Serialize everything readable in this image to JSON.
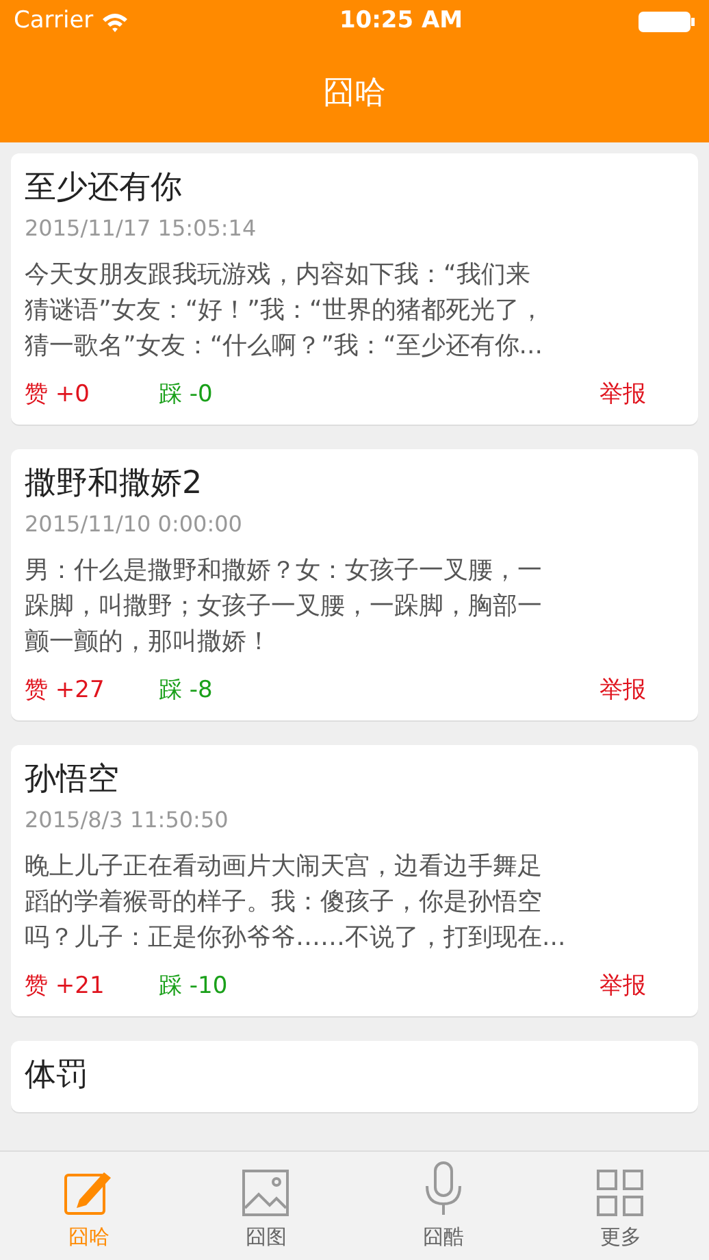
{
  "status_bar": {
    "carrier": "Carrier",
    "time": "10:25 AM"
  },
  "nav_bar": {
    "title": "囧哈"
  },
  "posts": [
    {
      "title": "至少还有你",
      "date": "2015/11/17 15:05:14",
      "body_lines": [
        "今天女朋友跟我玩游戏，内容如下我：“我们来",
        "猜谜语”女友：“好！”我：“世界的猪都死光了，",
        "猜一歌名”女友：“什么啊？”我：“至少还有你..."
      ],
      "likes": "赞 +0",
      "dislikes": "踩 -0",
      "report": "举报"
    },
    {
      "title": "撒野和撒娇2",
      "date": "2015/11/10 0:00:00",
      "body_lines": [
        "男：什么是撒野和撒娇？女：女孩子一叉腰，一",
        "跺脚，叫撒野；女孩子一叉腰，一跺脚，胸部一",
        "颤一颤的，那叫撒娇！"
      ],
      "likes": "赞 +27",
      "dislikes": "踩 -8",
      "report": "举报"
    },
    {
      "title": "孙悟空",
      "date": "2015/8/3 11:50:50",
      "body_lines": [
        "晚上儿子正在看动画片大闹天宫，边看边手舞足",
        "蹈的学着猴哥的样子。我：傻孩子，你是孙悟空",
        "吗？儿子：正是你孙爷爷……不说了，打到现在..."
      ],
      "likes": "赞 +21",
      "dislikes": "踩 -10",
      "report": "举报"
    },
    {
      "title": "体罚"
    }
  ],
  "tab_bar": [
    {
      "kind": "pencil",
      "label": "囧哈",
      "selected": true
    },
    {
      "kind": "picture",
      "label": "囧图",
      "selected": false
    },
    {
      "kind": "microphone",
      "label": "囧酷",
      "selected": false
    },
    {
      "kind": "grid",
      "label": "更多",
      "selected": false
    }
  ]
}
